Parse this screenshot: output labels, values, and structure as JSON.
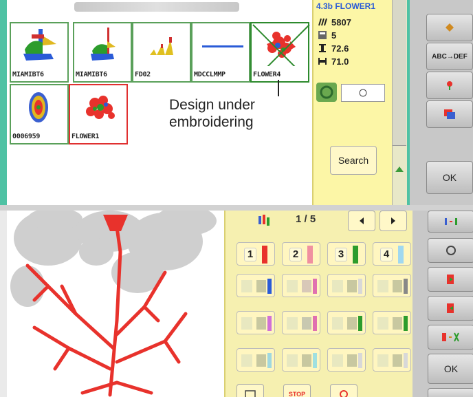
{
  "designs": [
    {
      "name": "MIAMIBT6"
    },
    {
      "name": "MIAMIBT6"
    },
    {
      "name": "FD02"
    },
    {
      "name": "MDCCLMMP"
    },
    {
      "name": "FLOWER4"
    },
    {
      "name": "0006959"
    },
    {
      "name": "FLOWER1"
    }
  ],
  "info": {
    "title": "4.3b FLOWER1",
    "stitches": "5807",
    "colors": "5",
    "height": "72.6",
    "width": "71.0"
  },
  "annotation": {
    "line1": "Design under",
    "line2": "embroidering"
  },
  "top_buttons": {
    "search": "Search",
    "ok": "OK",
    "abc_def": "ABC→DEF"
  },
  "bottom": {
    "page_indicator": "1 / 5",
    "needle_numbers": [
      "1",
      "2",
      "3",
      "4"
    ],
    "ok": "OK",
    "stop_label": "STOP"
  },
  "colors": {
    "teal": "#4fc2a4",
    "panel_yellow": "#fcf6a6",
    "selection_red": "#e03030",
    "thread_red": "#e8322c"
  }
}
